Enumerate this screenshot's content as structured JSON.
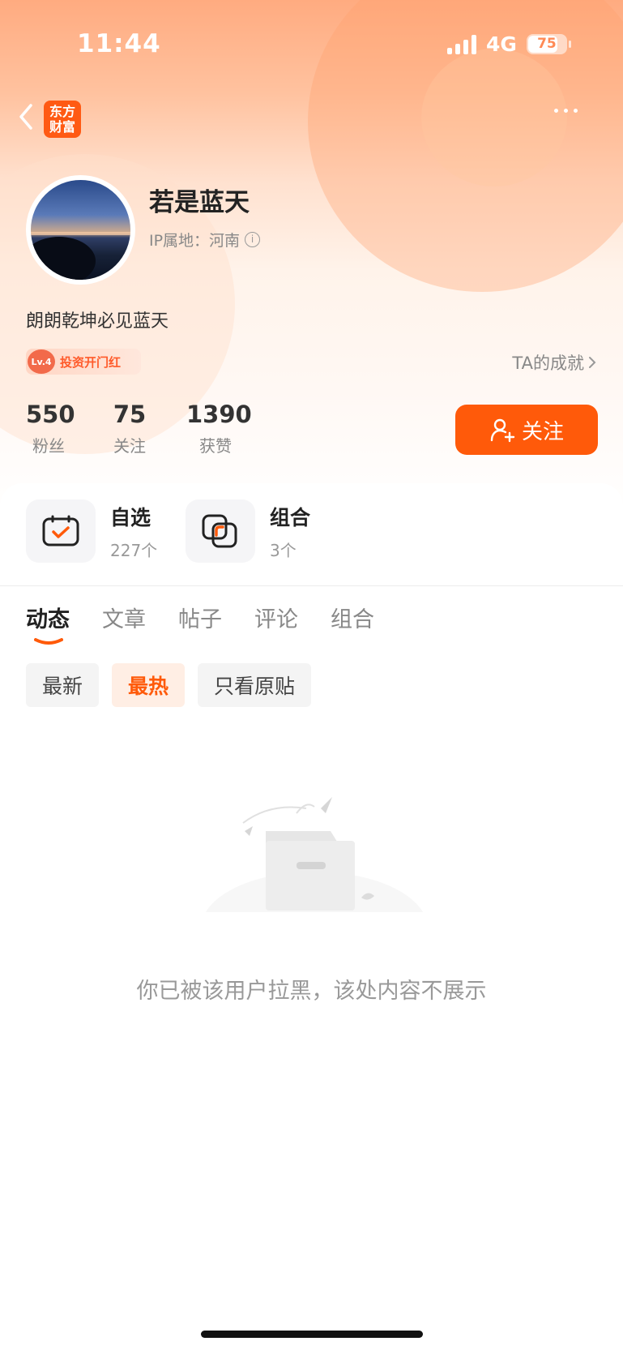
{
  "status_bar": {
    "time": "11:44",
    "network": "4G",
    "battery": "75"
  },
  "header": {
    "logo_line1": "东方",
    "logo_line2": "财富"
  },
  "profile": {
    "name": "若是蓝天",
    "ip_location": "IP属地：河南",
    "bio": "朗朗乾坤必见蓝天",
    "badge_level": "Lv.4",
    "badge_label": "投资开门红",
    "achievements_link": "TA的成就"
  },
  "stats": [
    {
      "value": "550",
      "label": "粉丝"
    },
    {
      "value": "75",
      "label": "关注"
    },
    {
      "value": "1390",
      "label": "获赞"
    }
  ],
  "follow_button": "关注",
  "shortcuts": [
    {
      "title": "自选",
      "subtitle": "227个"
    },
    {
      "title": "组合",
      "subtitle": "3个"
    }
  ],
  "tabs": [
    {
      "label": "动态",
      "active": true
    },
    {
      "label": "文章",
      "active": false
    },
    {
      "label": "帖子",
      "active": false
    },
    {
      "label": "评论",
      "active": false
    },
    {
      "label": "组合",
      "active": false
    }
  ],
  "filters": [
    {
      "label": "最新",
      "active": false
    },
    {
      "label": "最热",
      "active": true
    },
    {
      "label": "只看原贴",
      "active": false
    }
  ],
  "empty_state": {
    "message": "你已被该用户拉黑，该处内容不展示"
  },
  "colors": {
    "accent": "#ff5a0a",
    "brand": "#ff5a14"
  }
}
